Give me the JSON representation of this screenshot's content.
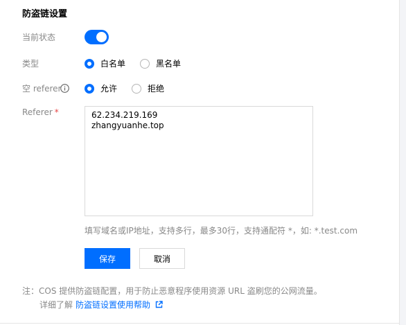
{
  "title": "防盗链设置",
  "status": {
    "label": "当前状态",
    "enabled": true
  },
  "type": {
    "label": "类型",
    "options": [
      "白名单",
      "黑名单"
    ],
    "selected": "白名单"
  },
  "empty_referer": {
    "label": "空 referer",
    "options": [
      "允许",
      "拒绝"
    ],
    "selected": "允许"
  },
  "referer": {
    "label": "Referer",
    "required_mark": "*",
    "value": "62.234.219.169\nzhangyuanhe.top",
    "hint": "填写域名或IP地址，支持多行，最多30行，支持通配符 *，如: *.test.com"
  },
  "buttons": {
    "save": "保存",
    "cancel": "取消"
  },
  "note": {
    "text": "注：COS 提供防盗链配置，用于防止恶意程序使用资源 URL 盗刷您的公网流量。",
    "more_prefix": "详细了解",
    "link_text": "防盗链设置使用帮助"
  },
  "colors": {
    "accent": "#006eff",
    "required": "#e54545",
    "muted": "#888888"
  },
  "icons": {
    "info": "info-icon",
    "external_link": "external-link-icon"
  }
}
